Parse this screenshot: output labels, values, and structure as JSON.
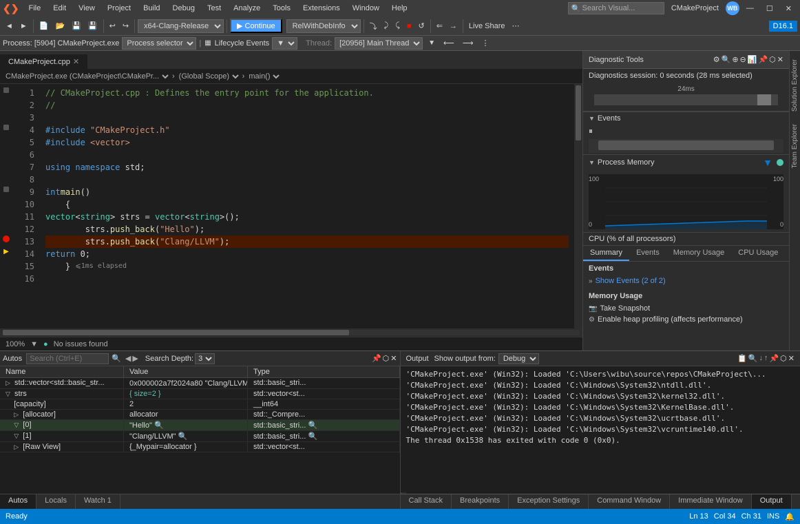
{
  "app": {
    "title": "CMakeProject",
    "logo": "VS"
  },
  "menu": {
    "items": [
      "File",
      "Edit",
      "View",
      "Project",
      "Build",
      "Debug",
      "Test",
      "Analyze",
      "Tools",
      "Extensions",
      "Window",
      "Help"
    ]
  },
  "toolbar": {
    "platform": "x64-Clang-Release",
    "continue_label": "▶ Continue",
    "debug_target": "RelWithDebInfo",
    "live_share": "Live Share",
    "badge": "D16.1"
  },
  "process_bar": {
    "process": "Process: [5904] CMakeProject.exe",
    "events": "Lifecycle Events",
    "thread_label": "Thread:",
    "thread": "[20956] Main Thread"
  },
  "editor": {
    "tab_name": "CMakeProject.cpp",
    "breadcrumb_left": "CMakeProject.exe (CMakeProject\\CMakePr...",
    "breadcrumb_middle": "(Global Scope)",
    "breadcrumb_right": "main()",
    "lines": [
      {
        "num": 1,
        "text": "// CMakeProject.cpp : Defines the entry point for the application.",
        "type": "comment",
        "gutter": "collapse"
      },
      {
        "num": 2,
        "text": "//",
        "type": "comment",
        "gutter": ""
      },
      {
        "num": 3,
        "text": "",
        "type": "normal",
        "gutter": ""
      },
      {
        "num": 4,
        "text": "#include \"CMakeProject.h\"",
        "type": "include",
        "gutter": "collapse"
      },
      {
        "num": 5,
        "text": "#include <vector>",
        "type": "include",
        "gutter": ""
      },
      {
        "num": 6,
        "text": "",
        "type": "normal",
        "gutter": ""
      },
      {
        "num": 7,
        "text": "    using namespace std;",
        "type": "normal",
        "gutter": ""
      },
      {
        "num": 8,
        "text": "",
        "type": "normal",
        "gutter": ""
      },
      {
        "num": 9,
        "text": "int main()",
        "type": "normal",
        "gutter": "collapse"
      },
      {
        "num": 10,
        "text": "    {",
        "type": "normal",
        "gutter": ""
      },
      {
        "num": 11,
        "text": "        vector<string> strs = vector<string>();",
        "type": "normal",
        "gutter": ""
      },
      {
        "num": 12,
        "text": "        strs.push_back(\"Hello\");",
        "type": "normal",
        "gutter": ""
      },
      {
        "num": 13,
        "text": "        strs.push_back(\"Clang/LLVM\");",
        "type": "active",
        "gutter": "breakpoint"
      },
      {
        "num": 14,
        "text": "        return 0;",
        "type": "normal",
        "gutter": "current"
      },
      {
        "num": 15,
        "text": "    } ≤ 1ms elapsed",
        "type": "normal",
        "gutter": ""
      },
      {
        "num": 16,
        "text": "",
        "type": "normal",
        "gutter": ""
      }
    ],
    "zoom": "100%",
    "status": "No issues found"
  },
  "diagnostic": {
    "title": "Diagnostic Tools",
    "session_text": "Diagnostics session: 0 seconds (28 ms selected)",
    "timeline_label": "24ms",
    "events_section": "Events",
    "memory_section": "Process Memory",
    "cpu_section": "CPU (% of all processors)",
    "chart_left_top": "100",
    "chart_left_bottom": "0",
    "chart_right_top": "100",
    "chart_right_bottom": "0",
    "tabs": [
      "Summary",
      "Events",
      "Memory Usage",
      "CPU Usage"
    ],
    "active_tab": "Summary",
    "events_label": "Events",
    "show_events": "Show Events (2 of 2)",
    "memory_usage_label": "Memory Usage",
    "take_snapshot": "Take Snapshot",
    "enable_heap": "Enable heap profiling (affects performance)"
  },
  "autos": {
    "panel_title": "Autos",
    "search_placeholder": "Search (Ctrl+E)",
    "search_depth_label": "Search Depth:",
    "search_depth_value": "3",
    "columns": [
      "Name",
      "Value",
      "Type"
    ],
    "rows": [
      {
        "indent": 0,
        "expand": "▷",
        "name": "std::vector<std::basic_str...",
        "value": "0x000002a7f2024a80 \"Clang/LLVM\"",
        "type": "std::basic_stri...",
        "highlight": false,
        "value_class": "normal"
      },
      {
        "indent": 0,
        "expand": "▽",
        "name": "strs",
        "value": "{ size=2 }",
        "type": "std::vector<st...",
        "highlight": false,
        "value_class": "green"
      },
      {
        "indent": 1,
        "expand": "",
        "name": "[capacity]",
        "value": "2",
        "type": "__int64",
        "highlight": false,
        "value_class": "normal"
      },
      {
        "indent": 1,
        "expand": "▷",
        "name": "[allocator]",
        "value": "allocator",
        "type": "std::_Compre...",
        "highlight": false,
        "value_class": "normal"
      },
      {
        "indent": 1,
        "expand": "▽",
        "name": "[0]",
        "value": "\"Hello\"",
        "type": "std::basic_stri...",
        "highlight": true,
        "value_class": "normal"
      },
      {
        "indent": 1,
        "expand": "▽",
        "name": "[1]",
        "value": "\"Clang/LLVM\"",
        "type": "std::basic_stri...",
        "highlight": false,
        "value_class": "normal"
      },
      {
        "indent": 1,
        "expand": "▷",
        "name": "[Raw View]",
        "value": "{_Mypair=allocator }",
        "type": "std::vector<st...",
        "highlight": false,
        "value_class": "normal"
      }
    ],
    "bottom_tabs": [
      "Autos",
      "Locals",
      "Watch 1"
    ]
  },
  "output": {
    "panel_title": "Output",
    "source_label": "Show output from:",
    "source_value": "Debug",
    "lines": [
      "'CMakeProject.exe' (Win32): Loaded 'C:\\Users\\wibu\\source\\repos\\CMakeProject\\...",
      "'CMakeProject.exe' (Win32): Loaded 'C:\\Windows\\System32\\ntdll.dll'.",
      "'CMakeProject.exe' (Win32): Loaded 'C:\\Windows\\System32\\kernel32.dll'.",
      "'CMakeProject.exe' (Win32): Loaded 'C:\\Windows\\System32\\KernelBase.dll'.",
      "'CMakeProject.exe' (Win32): Loaded 'C:\\Windows\\System32\\ucrtbase.dll'.",
      "'CMakeProject.exe' (Win32): Loaded 'C:\\Windows\\System32\\vcruntime140.dll'.",
      "The thread 0x1538 has exited with code 0 (0x0)."
    ],
    "bottom_tabs": [
      "Call Stack",
      "Breakpoints",
      "Exception Settings",
      "Command Window",
      "Immediate Window",
      "Output"
    ]
  },
  "status_bar": {
    "ready": "Ready",
    "ln": "Ln 13",
    "col": "Col 34",
    "ch": "Ch 31",
    "ins": "INS",
    "notification_icon": "🔔"
  }
}
